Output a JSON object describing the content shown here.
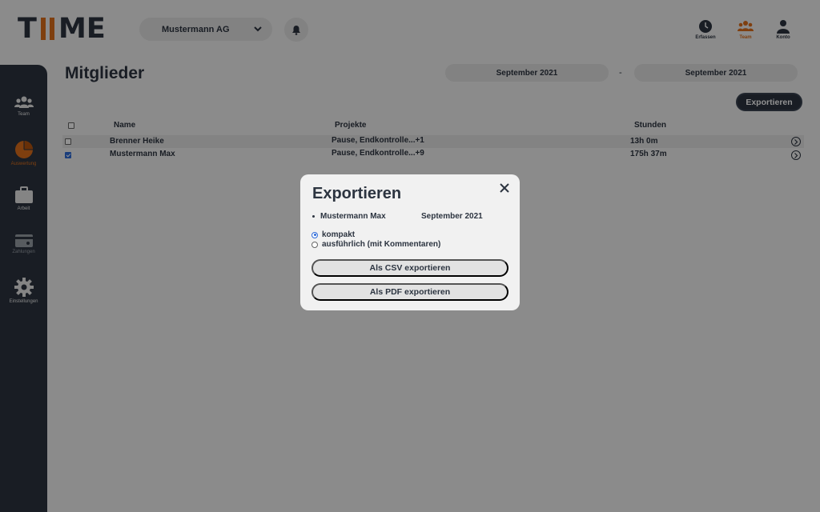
{
  "app": {
    "logo_text": "TIIME",
    "company": "Mustermann AG",
    "accent_color": "#e0701c",
    "dark_color": "#2c3440"
  },
  "topnav": [
    {
      "label": "Erfassen",
      "icon": "clock-icon",
      "active": false
    },
    {
      "label": "Team",
      "icon": "team-icon",
      "active": true
    },
    {
      "label": "Konto",
      "icon": "user-icon",
      "active": false
    }
  ],
  "sidebar": [
    {
      "label": "Team",
      "icon": "team-icon",
      "active": false
    },
    {
      "label": "Auswertung",
      "icon": "pie-chart-icon",
      "active": true
    },
    {
      "label": "Arbeit",
      "icon": "briefcase-icon",
      "active": false
    },
    {
      "label": "Zahlungen",
      "icon": "payment-card-icon",
      "active": false,
      "disabled": true
    },
    {
      "label": "Einstellungen",
      "icon": "gear-icon",
      "active": false
    }
  ],
  "main": {
    "title": "Mitglieder",
    "date_from": "September 2021",
    "date_separator": "-",
    "date_to": "September 2021",
    "export_label": "Exportieren",
    "columns": {
      "name": "Name",
      "projects": "Projekte",
      "hours": "Stunden"
    },
    "rows": [
      {
        "name": "Brenner Heike",
        "projects": "Pause, Endkontrolle...+1",
        "hours": "13h 0m",
        "checked": false
      },
      {
        "name": "Mustermann Max",
        "projects": "Pause, Endkontrolle...+9",
        "hours": "175h 37m",
        "checked": true
      }
    ]
  },
  "modal": {
    "title": "Exportieren",
    "member": "Mustermann Max",
    "period": "September 2021",
    "options": [
      {
        "label": "kompakt",
        "checked": true
      },
      {
        "label": "ausführlich (mit Kommentaren)",
        "checked": false
      }
    ],
    "csv_label": "Als CSV exportieren",
    "pdf_label": "Als PDF exportieren"
  }
}
